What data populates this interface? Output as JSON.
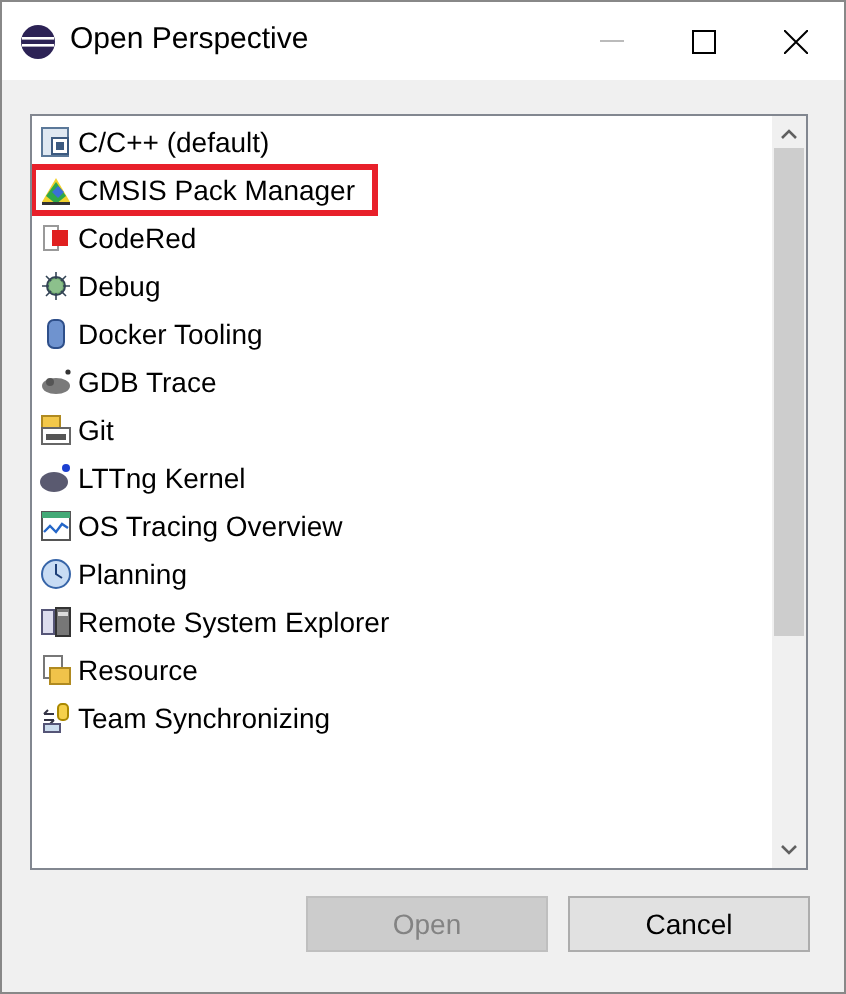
{
  "window": {
    "title": "Open Perspective"
  },
  "perspectives": [
    {
      "label": "C/C++ (default)",
      "highlighted": false
    },
    {
      "label": "CMSIS Pack Manager",
      "highlighted": true
    },
    {
      "label": "CodeRed",
      "highlighted": false
    },
    {
      "label": "Debug",
      "highlighted": false
    },
    {
      "label": "Docker Tooling",
      "highlighted": false
    },
    {
      "label": "GDB Trace",
      "highlighted": false
    },
    {
      "label": "Git",
      "highlighted": false
    },
    {
      "label": "LTTng Kernel",
      "highlighted": false
    },
    {
      "label": "OS Tracing Overview",
      "highlighted": false
    },
    {
      "label": "Planning",
      "highlighted": false
    },
    {
      "label": "Remote System Explorer",
      "highlighted": false
    },
    {
      "label": "Resource",
      "highlighted": false
    },
    {
      "label": "Team Synchronizing",
      "highlighted": false
    }
  ],
  "buttons": [
    {
      "label": "Open",
      "disabled": true
    },
    {
      "label": "Cancel",
      "disabled": false
    }
  ]
}
